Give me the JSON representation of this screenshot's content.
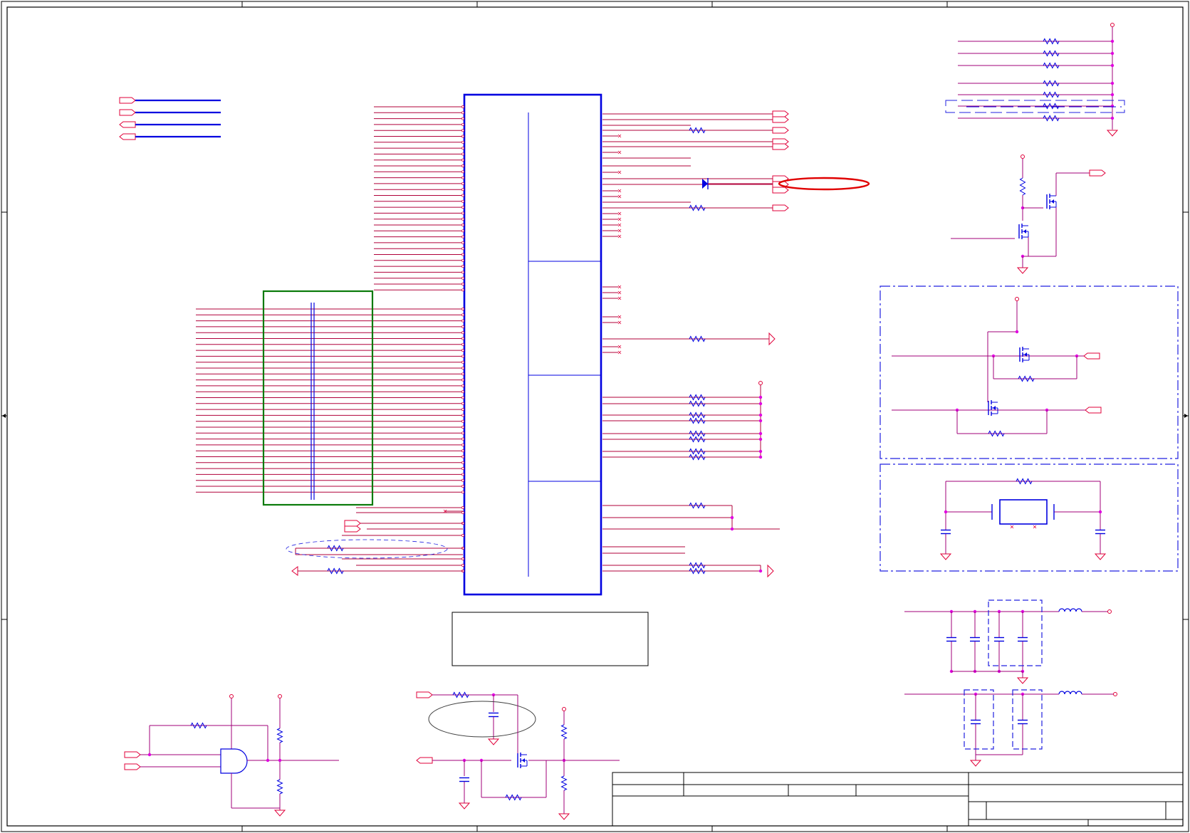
{
  "colors": {
    "frame": "#000000",
    "wire": "#b0003a",
    "net_magenta": "#a0007a",
    "component": "#0000e0",
    "junction": "#e000e0",
    "offpage": "#e0003a",
    "highlight_box": "#0a7a0a",
    "callout": "#e00000",
    "dashed_group": "#2020e0",
    "note_ellipse": "#404040"
  },
  "icons": [
    "resistor-icon",
    "capacitor-icon",
    "inductor-icon",
    "mosfet-icon",
    "diode-icon",
    "and-gate-icon",
    "ground-icon",
    "power-rail-icon",
    "offpage-connector-icon",
    "crystal-icon"
  ]
}
